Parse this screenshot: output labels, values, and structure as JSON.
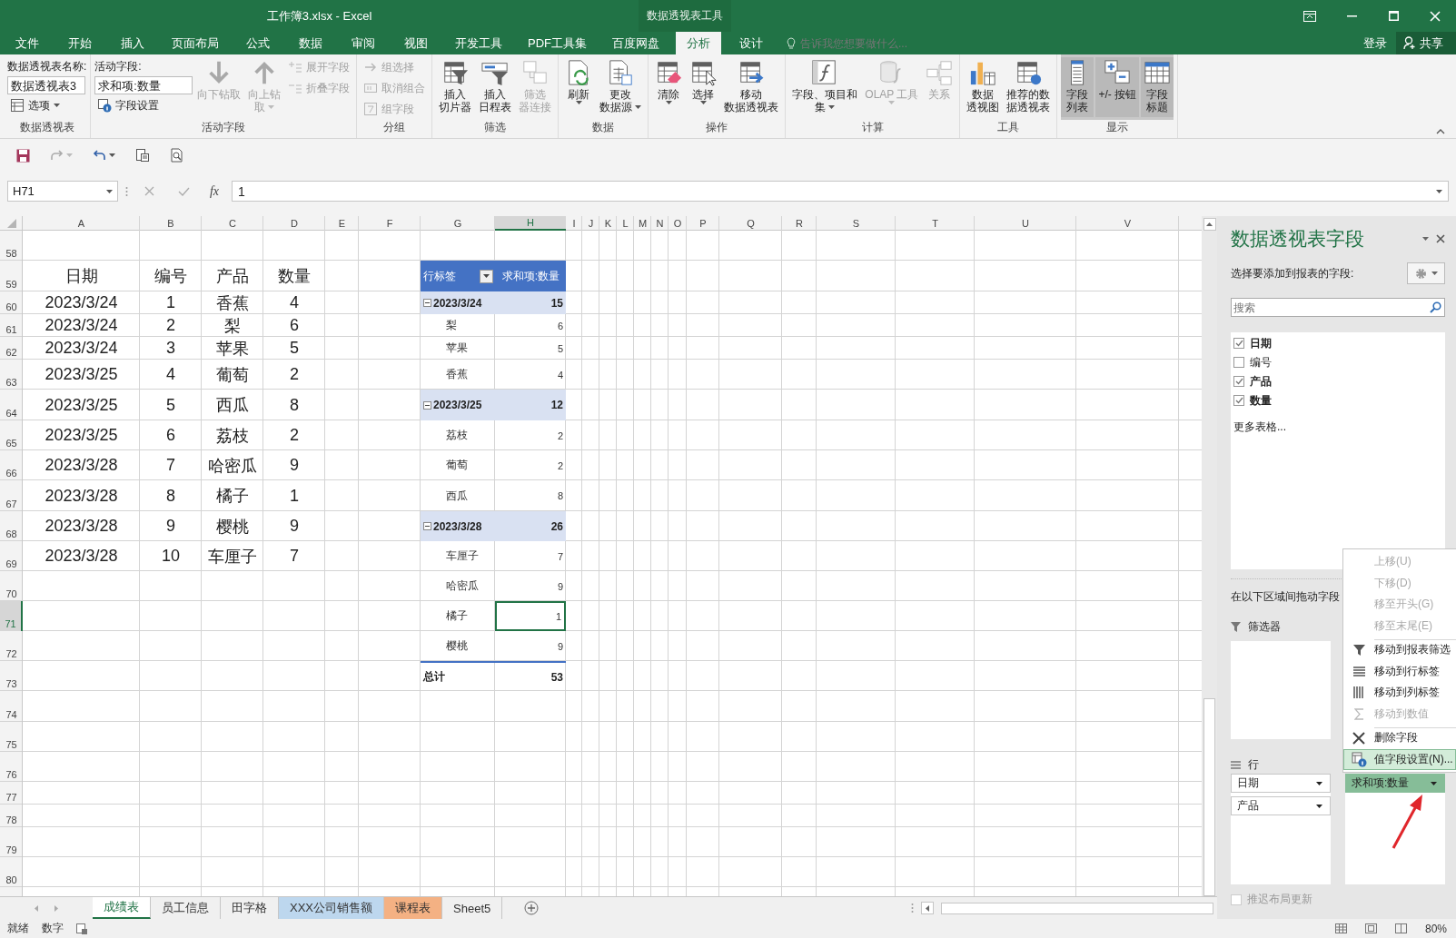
{
  "window": {
    "title": "工作簿3.xlsx - Excel",
    "context_tab_group": "数据透视表工具"
  },
  "menu_tabs": [
    {
      "label": "文件",
      "selected": false
    },
    {
      "label": "开始",
      "selected": false
    },
    {
      "label": "插入",
      "selected": false
    },
    {
      "label": "页面布局",
      "selected": false
    },
    {
      "label": "公式",
      "selected": false
    },
    {
      "label": "数据",
      "selected": false
    },
    {
      "label": "审阅",
      "selected": false
    },
    {
      "label": "视图",
      "selected": false
    },
    {
      "label": "开发工具",
      "selected": false
    },
    {
      "label": "PDF工具集",
      "selected": false
    },
    {
      "label": "百度网盘",
      "selected": false
    },
    {
      "label": "分析",
      "selected": true
    },
    {
      "label": "设计",
      "selected": false
    }
  ],
  "tell_me": {
    "placeholder": "告诉我您想要做什么..."
  },
  "account": {
    "sign_in": "登录",
    "share": "共享"
  },
  "ribbon": {
    "groups": [
      {
        "label": "数据透视表",
        "columns": [
          [
            {
              "kind": "caption",
              "label": "数据透视表名称:"
            },
            {
              "kind": "field",
              "value": "数据透视表3"
            },
            {
              "kind": "small",
              "label": "选项",
              "disabled": false,
              "dropdown": true
            }
          ]
        ]
      },
      {
        "label": "活动字段",
        "columns": [
          [
            {
              "kind": "caption",
              "label": "活动字段:"
            },
            {
              "kind": "field",
              "value": "求和项:数量"
            },
            {
              "kind": "small",
              "label": "字段设置",
              "disabled": false,
              "dropdown": false
            }
          ],
          [
            {
              "kind": "large",
              "lines": [
                "向下钻取"
              ],
              "disabled": true,
              "dropdown": false
            }
          ],
          [
            {
              "kind": "large",
              "lines": [
                "向上钻",
                "取"
              ],
              "disabled": true,
              "dropdown": true
            }
          ],
          [
            {
              "kind": "small",
              "label": "展开字段",
              "disabled": true,
              "dropdown": false
            },
            {
              "kind": "small",
              "label": "折叠字段",
              "disabled": true,
              "dropdown": false
            }
          ]
        ]
      },
      {
        "label": "分组",
        "columns": [
          [
            {
              "kind": "small",
              "label": "组选择",
              "disabled": true,
              "dropdown": false
            },
            {
              "kind": "small",
              "label": "取消组合",
              "disabled": true,
              "dropdown": false
            },
            {
              "kind": "small",
              "label": "组字段",
              "disabled": true,
              "dropdown": false
            }
          ]
        ]
      },
      {
        "label": "筛选",
        "columns": [
          [
            {
              "kind": "large",
              "lines": [
                "插入",
                "切片器"
              ],
              "disabled": false,
              "dropdown": false
            }
          ],
          [
            {
              "kind": "large",
              "lines": [
                "插入",
                "日程表"
              ],
              "disabled": false,
              "dropdown": false
            }
          ],
          [
            {
              "kind": "large",
              "lines": [
                "筛选",
                "器连接"
              ],
              "disabled": true,
              "dropdown": false
            }
          ]
        ]
      },
      {
        "label": "数据",
        "columns": [
          [
            {
              "kind": "large",
              "lines": [
                "刷新"
              ],
              "disabled": false,
              "dropdown": true
            }
          ],
          [
            {
              "kind": "large",
              "lines": [
                "更改",
                "数据源"
              ],
              "disabled": false,
              "dropdown": true
            }
          ]
        ]
      },
      {
        "label": "操作",
        "columns": [
          [
            {
              "kind": "large",
              "lines": [
                "清除"
              ],
              "disabled": false,
              "dropdown": true
            }
          ],
          [
            {
              "kind": "large",
              "lines": [
                "选择"
              ],
              "disabled": false,
              "dropdown": true
            }
          ],
          [
            {
              "kind": "large",
              "lines": [
                "移动",
                "数据透视表"
              ],
              "disabled": false,
              "dropdown": false
            }
          ]
        ]
      },
      {
        "label": "计算",
        "columns": [
          [
            {
              "kind": "large",
              "lines": [
                "字段、项目和",
                "集"
              ],
              "disabled": false,
              "dropdown": true
            }
          ],
          [
            {
              "kind": "large",
              "lines": [
                "OLAP 工具"
              ],
              "disabled": true,
              "dropdown": true
            }
          ],
          [
            {
              "kind": "large",
              "lines": [
                "关系"
              ],
              "disabled": true,
              "dropdown": false
            }
          ]
        ]
      },
      {
        "label": "工具",
        "columns": [
          [
            {
              "kind": "large",
              "lines": [
                "数据",
                "透视图"
              ],
              "disabled": false,
              "dropdown": false
            }
          ],
          [
            {
              "kind": "large",
              "lines": [
                "推荐的数",
                "据透视表"
              ],
              "disabled": false,
              "dropdown": false
            }
          ]
        ]
      },
      {
        "label": "显示",
        "columns": [
          [
            {
              "kind": "large",
              "lines": [
                "字段",
                "列表"
              ],
              "disabled": false,
              "dropdown": false,
              "on": true
            }
          ],
          [
            {
              "kind": "large",
              "lines": [
                "+/- 按钮"
              ],
              "disabled": false,
              "dropdown": false,
              "on": true
            }
          ],
          [
            {
              "kind": "large",
              "lines": [
                "字段",
                "标题"
              ],
              "disabled": false,
              "dropdown": false,
              "on": true
            }
          ]
        ]
      }
    ]
  },
  "formula_bar": {
    "name_box": "H71",
    "function_button": "fx",
    "formula": "1"
  },
  "sheet": {
    "columns": [
      "A",
      "B",
      "C",
      "D",
      "E",
      "F",
      "G",
      "H",
      "I",
      "J",
      "K",
      "L",
      "M",
      "N",
      "O",
      "P",
      "Q",
      "R",
      "S",
      "T",
      "U",
      "V"
    ],
    "rows": [
      "58",
      "59",
      "60",
      "61",
      "62",
      "63",
      "64",
      "65",
      "66",
      "67",
      "68",
      "69",
      "70",
      "71",
      "72",
      "73",
      "74",
      "75",
      "76",
      "77",
      "78",
      "79",
      "80"
    ],
    "data_table": {
      "headers": [
        "日期",
        "编号",
        "产品",
        "数量"
      ],
      "rows": [
        [
          "2023/3/24",
          "1",
          "香蕉",
          "4"
        ],
        [
          "2023/3/24",
          "2",
          "梨",
          "6"
        ],
        [
          "2023/3/24",
          "3",
          "苹果",
          "5"
        ],
        [
          "2023/3/25",
          "4",
          "葡萄",
          "2"
        ],
        [
          "2023/3/25",
          "5",
          "西瓜",
          "8"
        ],
        [
          "2023/3/25",
          "6",
          "荔枝",
          "2"
        ],
        [
          "2023/3/28",
          "7",
          "哈密瓜",
          "9"
        ],
        [
          "2023/3/28",
          "8",
          "橘子",
          "1"
        ],
        [
          "2023/3/28",
          "9",
          "樱桃",
          "9"
        ],
        [
          "2023/3/28",
          "10",
          "车厘子",
          "7"
        ]
      ]
    },
    "pivot": {
      "row_label": "行标签",
      "value_label": "求和项:数量",
      "groups": [
        {
          "label": "2023/3/24",
          "total": "15",
          "expanded": true,
          "items": [
            {
              "label": "梨",
              "value": "6",
              "selected": false
            },
            {
              "label": "苹果",
              "value": "5",
              "selected": false
            },
            {
              "label": "香蕉",
              "value": "4",
              "selected": false
            }
          ]
        },
        {
          "label": "2023/3/25",
          "total": "12",
          "expanded": true,
          "items": [
            {
              "label": "荔枝",
              "value": "2",
              "selected": false
            },
            {
              "label": "葡萄",
              "value": "2",
              "selected": false
            },
            {
              "label": "西瓜",
              "value": "8",
              "selected": false
            }
          ]
        },
        {
          "label": "2023/3/28",
          "total": "26",
          "expanded": true,
          "items": [
            {
              "label": "车厘子",
              "value": "7",
              "selected": false
            },
            {
              "label": "哈密瓜",
              "value": "9",
              "selected": false
            },
            {
              "label": "橘子",
              "value": "1",
              "selected": true
            },
            {
              "label": "樱桃",
              "value": "9",
              "selected": false
            }
          ]
        }
      ],
      "grand_total": {
        "label": "总计",
        "value": "53"
      }
    }
  },
  "sheet_tabs": [
    {
      "label": "成绩表",
      "selected": true
    },
    {
      "label": "员工信息",
      "selected": false
    },
    {
      "label": "田字格",
      "selected": false
    },
    {
      "label": "XXX公司销售额",
      "selected": false,
      "color": "#bdd7ee"
    },
    {
      "label": "课程表",
      "selected": false,
      "color": "#f4b183"
    },
    {
      "label": "Sheet5",
      "selected": false
    }
  ],
  "status_bar": {
    "ready": "就绪",
    "mode": "数字",
    "zoom": "80%"
  },
  "field_pane": {
    "title": "数据透视表字段",
    "subtitle": "选择要添加到报表的字段:",
    "search": {
      "placeholder": "搜索"
    },
    "fields": [
      {
        "label": "日期",
        "checked": true
      },
      {
        "label": "编号",
        "checked": false
      },
      {
        "label": "产品",
        "checked": true
      },
      {
        "label": "数量",
        "checked": true
      }
    ],
    "more_tables": "更多表格...",
    "areas_caption": "在以下区域间拖动字段",
    "filters_label": "筛选器",
    "rows_label": "行",
    "row_items": [
      {
        "label": "日期",
        "selected": false
      },
      {
        "label": "产品",
        "selected": false
      }
    ],
    "value_items": [
      {
        "label": "求和项:数量",
        "selected": true
      }
    ],
    "defer": {
      "label": "推迟布局更新",
      "checked": false
    }
  },
  "context_menu": {
    "items": [
      {
        "label": "上移(U)",
        "disabled": true,
        "selected": false,
        "separator_before": false
      },
      {
        "label": "下移(D)",
        "disabled": true,
        "selected": false,
        "separator_before": false
      },
      {
        "label": "移至开头(G)",
        "disabled": true,
        "selected": false,
        "separator_before": false
      },
      {
        "label": "移至末尾(E)",
        "disabled": true,
        "selected": false,
        "separator_before": false
      },
      {
        "label": "移动到报表筛选",
        "disabled": false,
        "selected": false,
        "separator_before": true
      },
      {
        "label": "移动到行标签",
        "disabled": false,
        "selected": false,
        "separator_before": false
      },
      {
        "label": "移动到列标签",
        "disabled": false,
        "selected": false,
        "separator_before": false
      },
      {
        "label": "移动到数值",
        "disabled": true,
        "selected": false,
        "separator_before": false
      },
      {
        "label": "删除字段",
        "disabled": false,
        "selected": false,
        "separator_before": true
      },
      {
        "label": "值字段设置(N)...",
        "disabled": false,
        "selected": true,
        "separator_before": false
      }
    ]
  }
}
